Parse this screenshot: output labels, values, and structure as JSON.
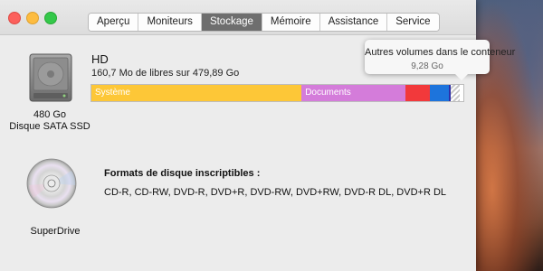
{
  "window": {
    "tabs": [
      {
        "label": "Aperçu"
      },
      {
        "label": "Moniteurs"
      },
      {
        "label": "Stockage"
      },
      {
        "label": "Mémoire"
      },
      {
        "label": "Assistance"
      },
      {
        "label": "Service"
      }
    ],
    "active_tab": "Stockage"
  },
  "disk": {
    "icon": "hard-drive-icon",
    "capacity": "480 Go",
    "type": "Disque SATA SSD",
    "volume_name": "HD",
    "free_text": "160,7 Mo de libres sur 479,89 Go",
    "usage_bar": [
      {
        "name": "Système",
        "fraction": 0.565,
        "color": "#fdc737",
        "show_label": true
      },
      {
        "name": "Documents",
        "fraction": 0.28,
        "color": "#d47cda",
        "show_label": true
      },
      {
        "name": "",
        "fraction": 0.065,
        "color": "#f2393b",
        "show_label": false
      },
      {
        "name": "",
        "fraction": 0.05,
        "color": "#1d74dc",
        "show_label": false
      },
      {
        "name": "",
        "fraction": 0.006,
        "color": "#2f2fa8",
        "show_label": false
      },
      {
        "name": "",
        "fraction": 0.024,
        "color": "#e4e4e4",
        "striped": true,
        "show_label": false
      }
    ]
  },
  "tooltip": {
    "title": "Autres volumes dans le conteneur",
    "value": "9,28 Go"
  },
  "superdrive": {
    "icon": "optical-disc-icon",
    "label": "SuperDrive",
    "formats_title": "Formats de disque inscriptibles :",
    "formats": "CD-R, CD-RW, DVD-R, DVD+R, DVD-RW, DVD+RW, DVD-R DL, DVD+R DL"
  },
  "colors": {
    "active_tab_bg": "#6e6e6e",
    "window_bg": "#ececec"
  }
}
